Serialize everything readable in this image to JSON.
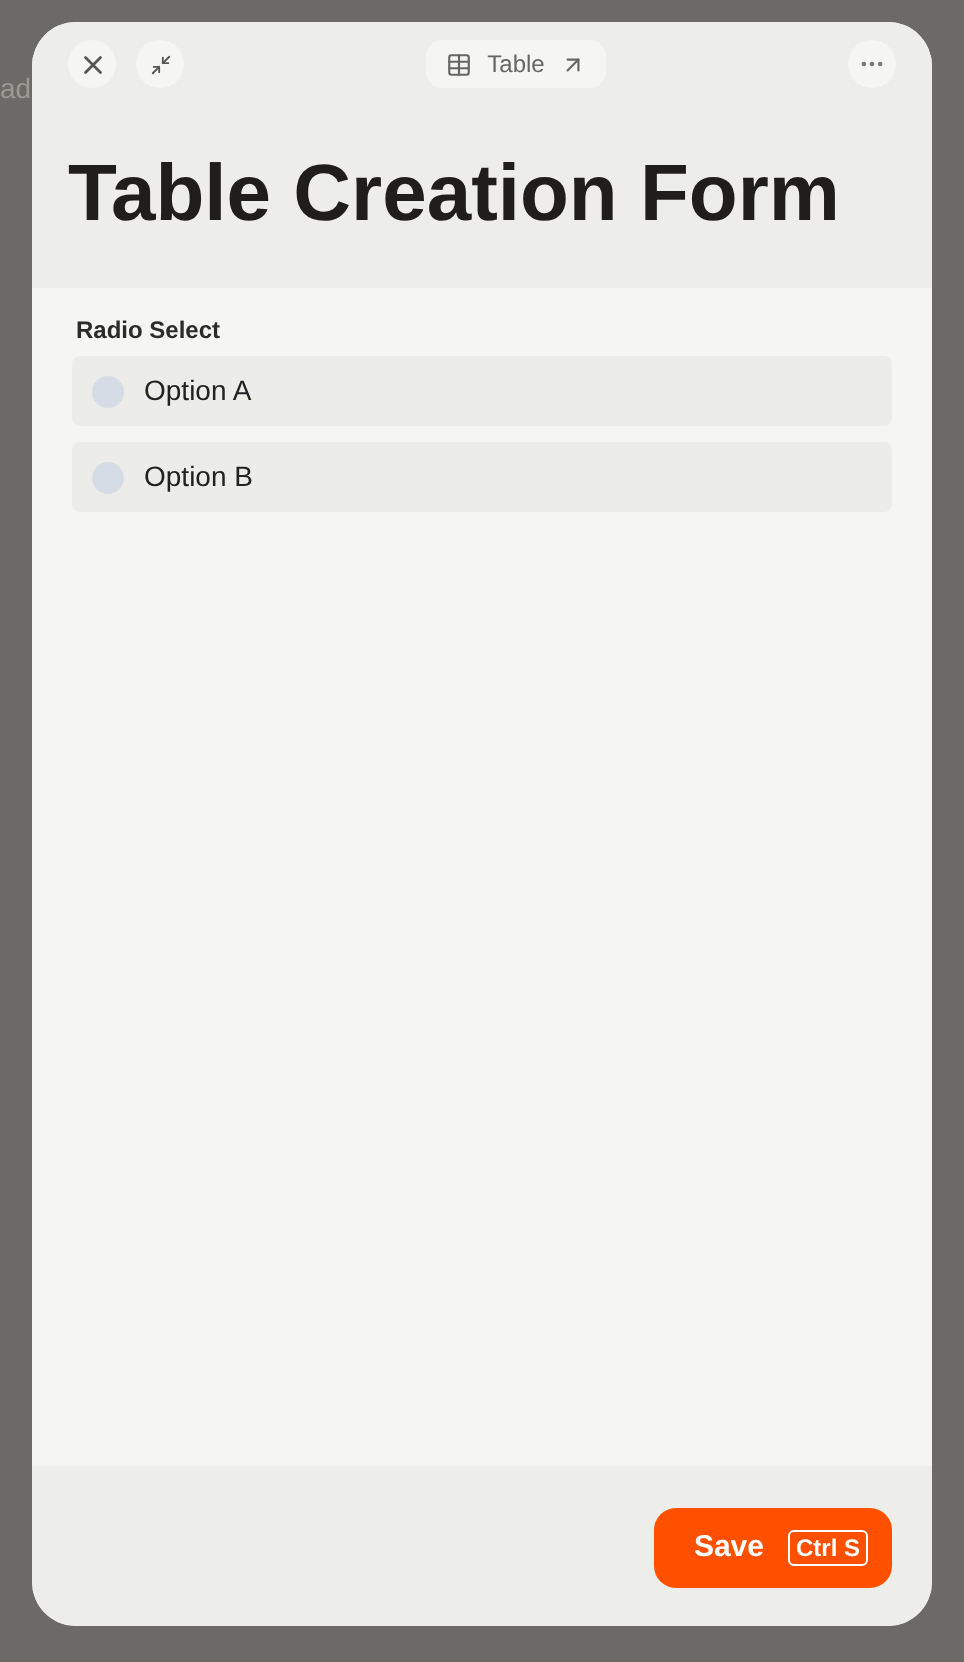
{
  "backdrop": {
    "text": "ad"
  },
  "toolbar": {
    "badge": {
      "label": "Table"
    }
  },
  "title": "Table Creation Form",
  "field": {
    "label": "Radio Select",
    "options": [
      {
        "label": "Option A",
        "selected": false
      },
      {
        "label": "Option B",
        "selected": false
      }
    ]
  },
  "footer": {
    "save": {
      "label": "Save",
      "shortcut": "Ctrl S"
    }
  }
}
